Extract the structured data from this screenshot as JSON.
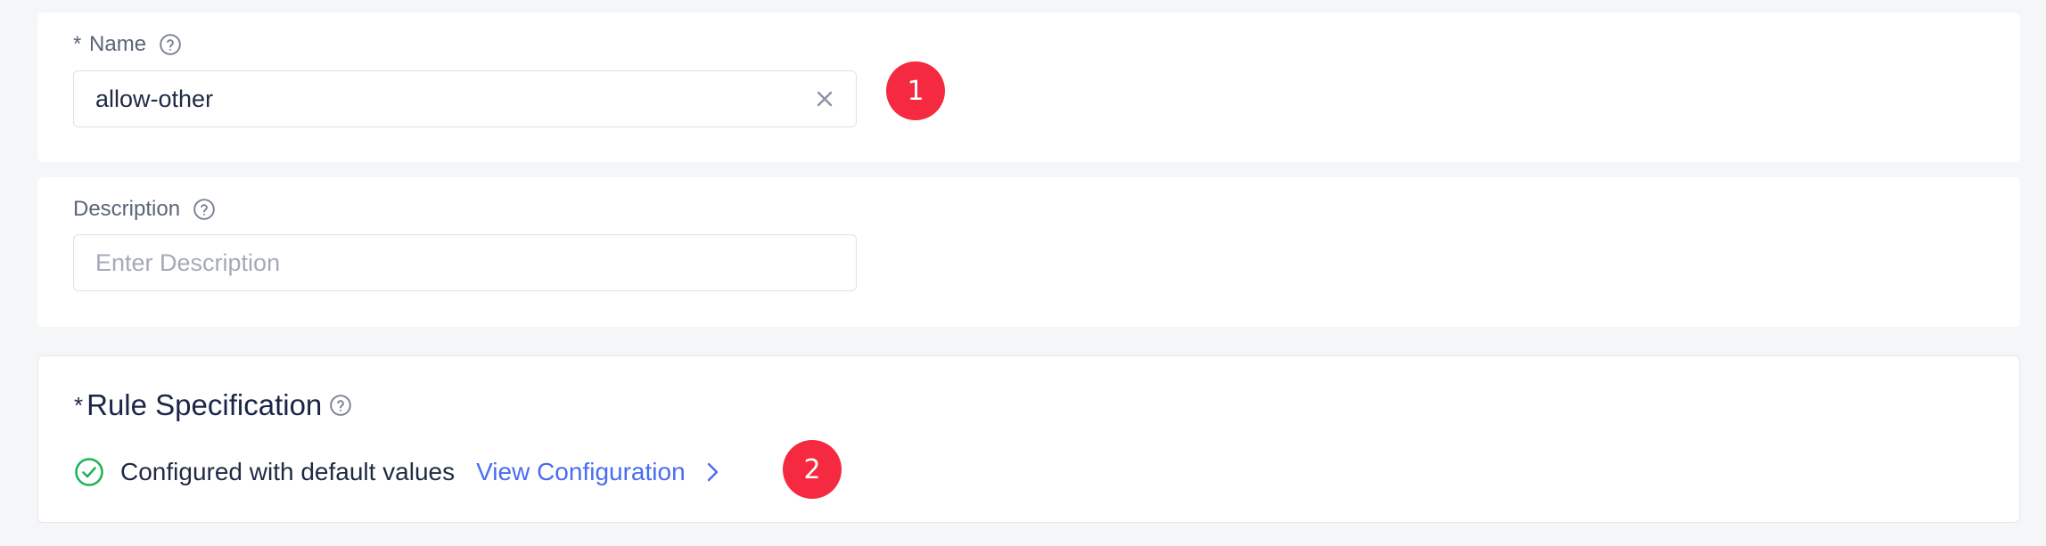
{
  "name_field": {
    "required_mark": "*",
    "label": "Name",
    "value": "allow-other",
    "placeholder": ""
  },
  "description_field": {
    "label": "Description",
    "value": "",
    "placeholder": "Enter Description"
  },
  "rule_specification": {
    "required_mark": "*",
    "title": "Rule Specification",
    "status_text": "Configured with default values",
    "link_label": "View Configuration"
  },
  "annotations": {
    "marker_1": "1",
    "marker_2": "2"
  },
  "icons": {
    "help": "question-circle-icon",
    "clear": "close-icon",
    "status": "check-circle-icon",
    "link_arrow": "chevron-right-icon"
  },
  "colors": {
    "accent": "#4a6cf0",
    "success": "#22b357",
    "marker": "#f5293f",
    "page_background": "#f5f6f8"
  }
}
